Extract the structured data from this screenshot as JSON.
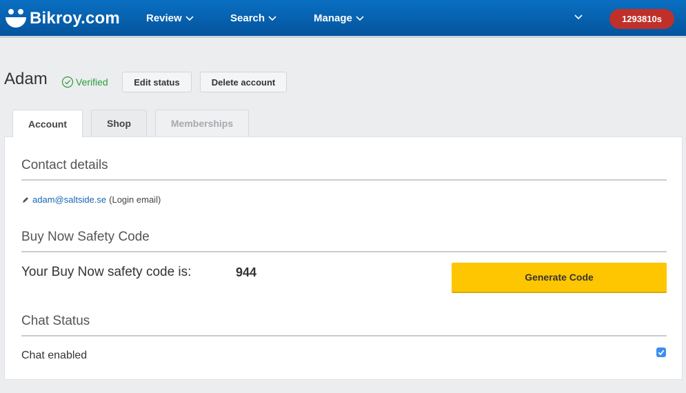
{
  "brand": {
    "name": "Bikroy.com",
    "logo_icon": "smiley-icon"
  },
  "nav": {
    "review": "Review",
    "search": "Search",
    "manage": "Manage",
    "user_badge": "1293810s"
  },
  "user": {
    "name": "Adam",
    "verified_label": "Verified",
    "edit_status": "Edit status",
    "delete_account": "Delete account"
  },
  "tabs": [
    {
      "label": "Account",
      "active": true
    },
    {
      "label": "Shop",
      "active": false
    },
    {
      "label": "Memberships",
      "active": false,
      "disabled": true
    }
  ],
  "contact": {
    "title": "Contact details",
    "email": "adam@saltside.se",
    "email_note": "(Login email)"
  },
  "safety": {
    "title": "Buy Now Safety Code",
    "label": "Your Buy Now safety code is:",
    "code": "944",
    "generate_label": "Generate Code"
  },
  "chat": {
    "title": "Chat Status",
    "label": "Chat enabled",
    "enabled": true
  },
  "colors": {
    "nav_bg": "#0a6fc2",
    "badge": "#c0302a",
    "verified": "#2b9d3a",
    "link": "#1766b6",
    "generate_button": "#fec600",
    "checkbox": "#3d8ef0"
  }
}
